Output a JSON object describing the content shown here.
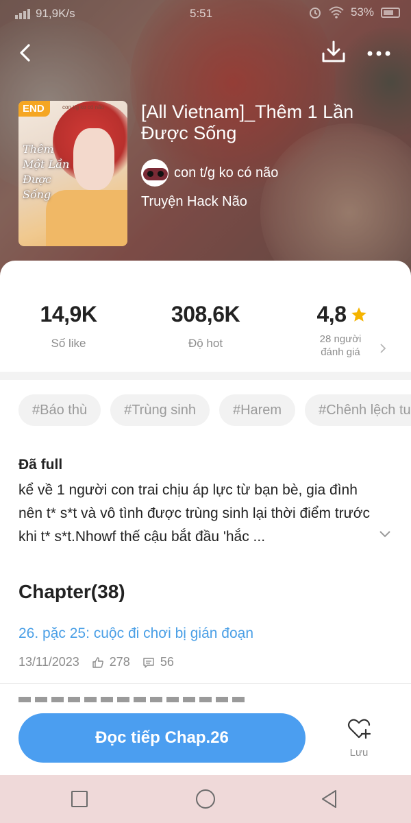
{
  "status_bar": {
    "net_speed": "91,9K/s",
    "time": "5:51",
    "battery": "53%"
  },
  "nav": {
    "back_icon": "chevron-left-icon",
    "download_icon": "download-icon",
    "more_icon": "more-dots-icon"
  },
  "book": {
    "badge": "END",
    "cover_credit": "con t/g ko có não",
    "cover_title": "Thêm Một Lần Được Sống",
    "title": "[All Vietnam]_Thêm 1 Lần Được Sống",
    "author": "con t/g ko có não",
    "genre": "Truyện Hack Não"
  },
  "stats": {
    "likes": {
      "value": "14,9K",
      "label": "Số like"
    },
    "hot": {
      "value": "308,6K",
      "label": "Độ hot"
    },
    "rating": {
      "value": "4,8",
      "label": "28 người đánh giá",
      "star_color": "#f5b400"
    }
  },
  "tags": [
    "#Báo thù",
    "#Trùng sinh",
    "#Harem",
    "#Chênh lệch tuổi"
  ],
  "description": {
    "status": "Đã full",
    "text": "kể về 1 người con trai chịu áp lực từ bạn bè, gia đình nên t* s*t và vô tình được trùng sinh lại thời điểm trước khi t* s*t.Nhowf thế cậu bắt đầu 'hắc ..."
  },
  "chapters": {
    "heading": "Chapter(38)",
    "items": [
      {
        "title": "26. pặc 25: cuộc đi chơi bị gián đoạn",
        "date": "13/11/2023",
        "likes": "278",
        "comments": "56"
      }
    ]
  },
  "actions": {
    "read_button": "Đọc tiếp Chap.26",
    "save_label": "Lưu"
  },
  "colors": {
    "accent": "#4b9ef0",
    "link": "#4a9fe6",
    "badge": "#f5a623"
  }
}
